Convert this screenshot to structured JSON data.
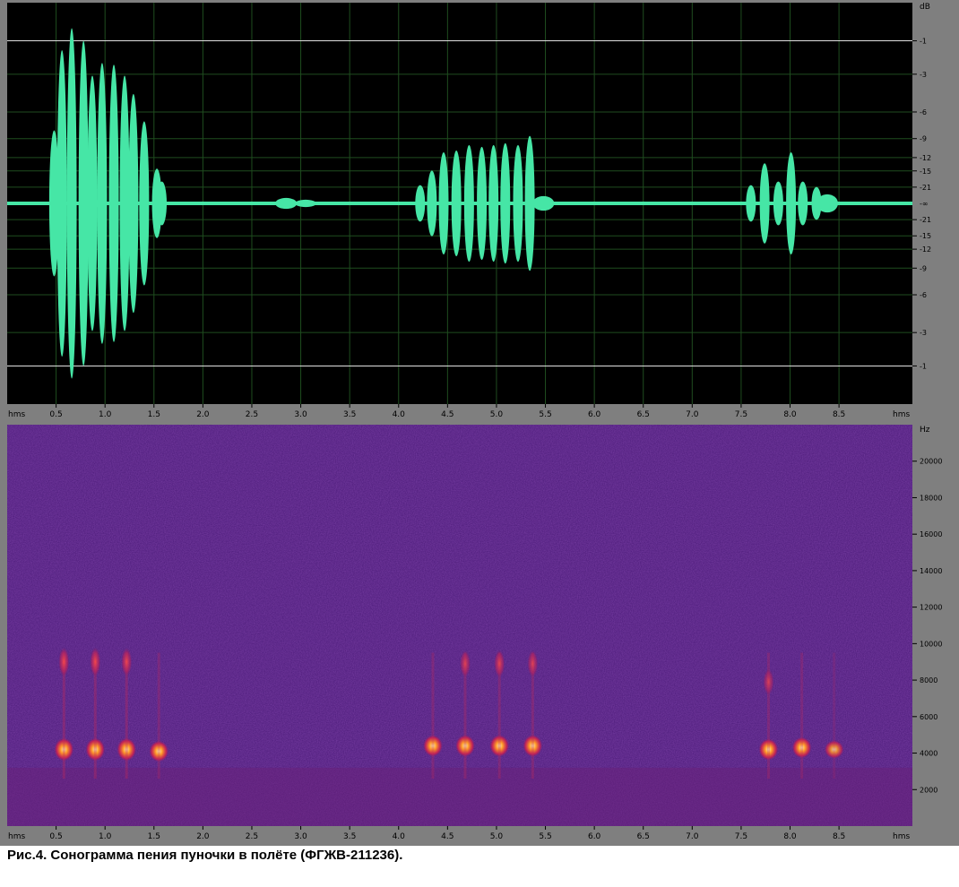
{
  "caption": "Рис.4. Сонограмма пения пуночки в полёте (ФГЖВ-211236).",
  "colors": {
    "frame": "#7f7f7f",
    "plot_background": "#000000",
    "grid": "#1f4d1f",
    "waveform": "#46e6a6",
    "clip_line": "#e0e0e0",
    "axis_text": "#000000",
    "spectrogram_background": "#4a1a78",
    "spectrogram_hot": "#ff8020",
    "spectrogram_core": "#fff0a0"
  },
  "chart_data": [
    {
      "type": "area",
      "name": "waveform",
      "xunit": "hms",
      "ylabel": "dB",
      "xlim": [
        0,
        9.25
      ],
      "xticks": [
        "0.5",
        "1.0",
        "1.5",
        "2.0",
        "2.5",
        "3.0",
        "3.5",
        "4.0",
        "4.5",
        "5.0",
        "5.5",
        "6.0",
        "6.5",
        "7.0",
        "7.5",
        "8.0",
        "8.5"
      ],
      "xtick_values": [
        0.5,
        1.0,
        1.5,
        2.0,
        2.5,
        3.0,
        3.5,
        4.0,
        4.5,
        5.0,
        5.5,
        6.0,
        6.5,
        7.0,
        7.5,
        8.0,
        8.5
      ],
      "yticks_upper": [
        "-1",
        "-3",
        "-6",
        "-9",
        "-12",
        "-15",
        "-21"
      ],
      "yticks_center": "-∞",
      "yticks_lower": [
        "-21",
        "-15",
        "-12",
        "-9",
        "-6",
        "-3",
        "-1"
      ],
      "ytick_amplitudes": [
        0.891,
        0.708,
        0.501,
        0.355,
        0.251,
        0.178,
        0.089
      ],
      "amplitude_ylim": [
        -1.1,
        1.1
      ],
      "noise_amplitude": 0.012,
      "pulses": [
        {
          "t": 0.48,
          "amp": 0.4
        },
        {
          "t": 0.56,
          "amp": 0.84
        },
        {
          "t": 0.66,
          "amp": 0.96
        },
        {
          "t": 0.78,
          "amp": 0.89
        },
        {
          "t": 0.87,
          "amp": 0.7
        },
        {
          "t": 0.97,
          "amp": 0.77
        },
        {
          "t": 1.09,
          "amp": 0.76
        },
        {
          "t": 1.2,
          "amp": 0.7
        },
        {
          "t": 1.29,
          "amp": 0.6
        },
        {
          "t": 1.4,
          "amp": 0.45
        },
        {
          "t": 1.53,
          "amp": 0.19
        },
        {
          "t": 1.58,
          "amp": 0.12
        },
        {
          "t": 2.85,
          "amp": 0.03
        },
        {
          "t": 3.05,
          "amp": 0.02
        },
        {
          "t": 4.22,
          "amp": 0.1
        },
        {
          "t": 4.34,
          "amp": 0.18
        },
        {
          "t": 4.46,
          "amp": 0.28
        },
        {
          "t": 4.59,
          "amp": 0.29
        },
        {
          "t": 4.72,
          "amp": 0.32
        },
        {
          "t": 4.85,
          "amp": 0.31
        },
        {
          "t": 4.97,
          "amp": 0.32
        },
        {
          "t": 5.09,
          "amp": 0.33
        },
        {
          "t": 5.22,
          "amp": 0.32
        },
        {
          "t": 5.34,
          "amp": 0.37
        },
        {
          "t": 5.48,
          "amp": 0.04
        },
        {
          "t": 7.6,
          "amp": 0.1
        },
        {
          "t": 7.74,
          "amp": 0.22
        },
        {
          "t": 7.88,
          "amp": 0.12
        },
        {
          "t": 8.01,
          "amp": 0.28
        },
        {
          "t": 8.13,
          "amp": 0.12
        },
        {
          "t": 8.27,
          "amp": 0.09
        },
        {
          "t": 8.38,
          "amp": 0.05
        }
      ]
    },
    {
      "type": "heatmap",
      "name": "spectrogram",
      "xunit": "hms",
      "yunit": "Hz",
      "ylabel": "Hz",
      "xlim": [
        0,
        9.25
      ],
      "ylim": [
        0,
        22000
      ],
      "xticks": [
        "0.5",
        "1.0",
        "1.5",
        "2.0",
        "2.5",
        "3.0",
        "3.5",
        "4.0",
        "4.5",
        "5.0",
        "5.5",
        "6.0",
        "6.5",
        "7.0",
        "7.5",
        "8.0",
        "8.5"
      ],
      "xtick_values": [
        0.5,
        1.0,
        1.5,
        2.0,
        2.5,
        3.0,
        3.5,
        4.0,
        4.5,
        5.0,
        5.5,
        6.0,
        6.5,
        7.0,
        7.5,
        8.0,
        8.5
      ],
      "yticks": [
        "2000",
        "4000",
        "6000",
        "8000",
        "10000",
        "12000",
        "14000",
        "16000",
        "18000",
        "20000"
      ],
      "ytick_values": [
        2000,
        4000,
        6000,
        8000,
        10000,
        12000,
        14000,
        16000,
        18000,
        20000
      ],
      "notes": [
        {
          "t": 0.58,
          "f": 4200,
          "intensity": 1.0
        },
        {
          "t": 0.58,
          "f": 9000,
          "intensity": 0.55
        },
        {
          "t": 0.9,
          "f": 4200,
          "intensity": 1.0
        },
        {
          "t": 0.9,
          "f": 9000,
          "intensity": 0.55
        },
        {
          "t": 1.22,
          "f": 4200,
          "intensity": 1.0
        },
        {
          "t": 1.22,
          "f": 9000,
          "intensity": 0.5
        },
        {
          "t": 1.55,
          "f": 4100,
          "intensity": 0.8
        },
        {
          "t": 4.35,
          "f": 4400,
          "intensity": 0.85
        },
        {
          "t": 4.68,
          "f": 4400,
          "intensity": 0.9
        },
        {
          "t": 5.03,
          "f": 4400,
          "intensity": 0.9
        },
        {
          "t": 5.37,
          "f": 4400,
          "intensity": 0.9
        },
        {
          "t": 4.68,
          "f": 8900,
          "intensity": 0.4
        },
        {
          "t": 5.03,
          "f": 8900,
          "intensity": 0.45
        },
        {
          "t": 5.37,
          "f": 8900,
          "intensity": 0.4
        },
        {
          "t": 7.78,
          "f": 4200,
          "intensity": 0.85
        },
        {
          "t": 8.12,
          "f": 4300,
          "intensity": 0.8
        },
        {
          "t": 8.45,
          "f": 4200,
          "intensity": 0.5
        },
        {
          "t": 7.78,
          "f": 7900,
          "intensity": 0.35
        }
      ]
    }
  ]
}
